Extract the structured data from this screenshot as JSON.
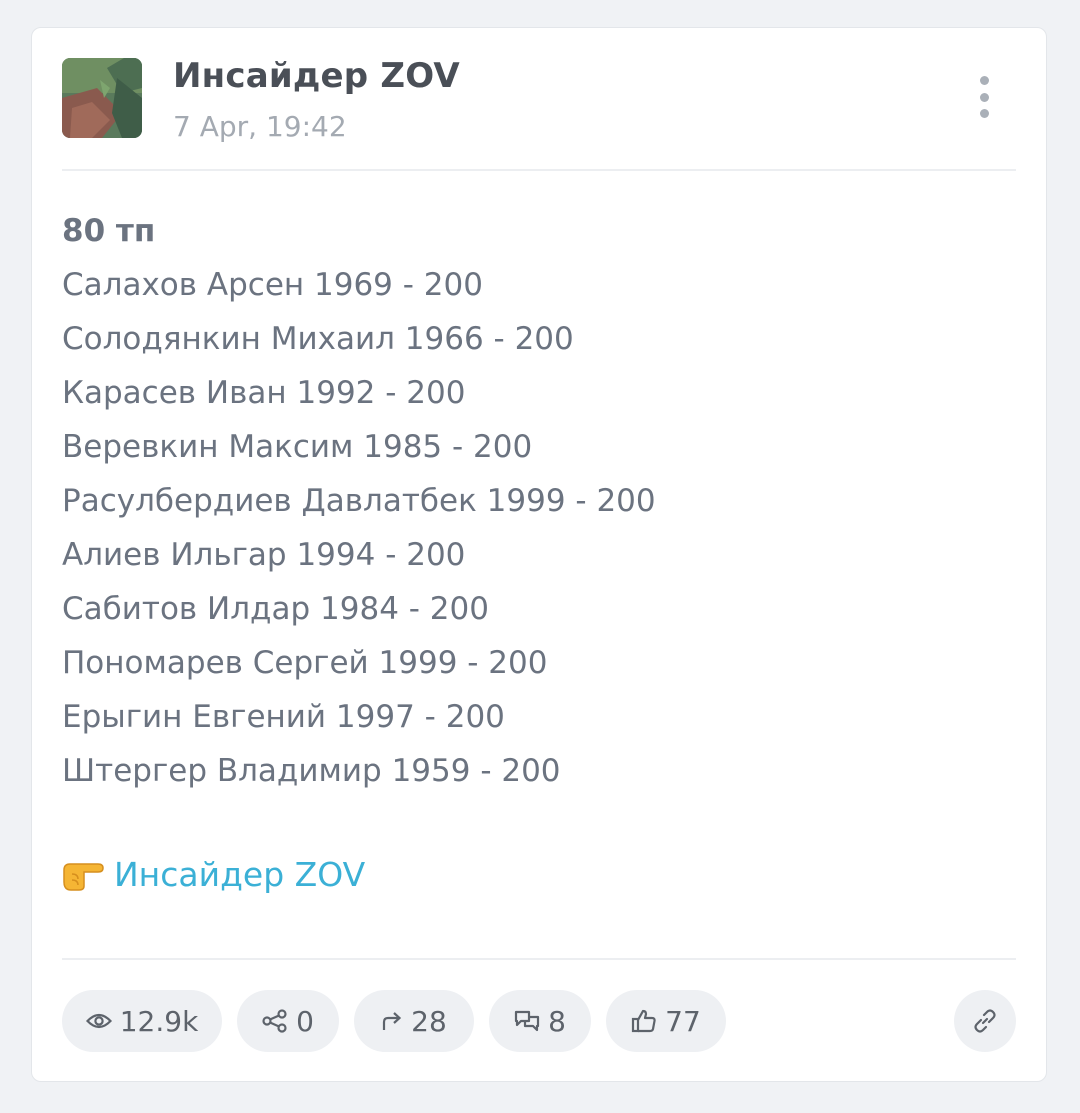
{
  "post": {
    "channel_name": "Инсайдер ZOV",
    "date": "7 Apr, 19:42",
    "title": "80 тп",
    "lines": [
      "Салахов Арсен 1969 - 200",
      "Солодянкин Михаил 1966 - 200",
      "Карасев Иван 1992 - 200",
      "Веревкин Максим 1985 - 200",
      "Расулбердиев Давлатбек 1999 - 200",
      "Алиев Ильгар 1994 - 200",
      "Сабитов Илдар 1984 - 200",
      "Пономарев Сергей 1999 - 200",
      "Ерыгин Евгений 1997 - 200",
      "Штергер Владимир 1959 - 200"
    ],
    "signature_link": "Инсайдер ZOV",
    "signature_icon": "pointing-hand-icon"
  },
  "stats": {
    "views": "12.9k",
    "shares": "0",
    "forwards": "28",
    "comments": "8",
    "likes": "77"
  },
  "colors": {
    "link": "#3bb0d6",
    "text": "#6b7380",
    "background": "#f0f2f5"
  }
}
